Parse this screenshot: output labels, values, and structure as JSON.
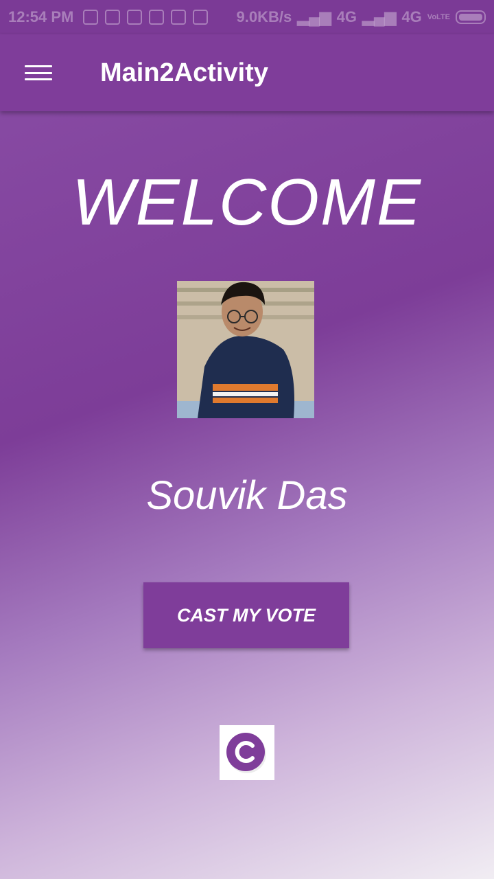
{
  "status_bar": {
    "time": "12:54 PM",
    "network_speed": "9.0KB/s",
    "network_1": "4G",
    "network_2": "4G",
    "volte": "VoLTE"
  },
  "toolbar": {
    "title": "Main2Activity",
    "menu_icon": "hamburger-menu-icon"
  },
  "main": {
    "heading": "WELCOME",
    "user_name": "Souvik Das",
    "vote_button_label": "CAST MY VOTE"
  },
  "colors": {
    "primary": "#7f3d9a",
    "accent": "#ffffff"
  }
}
